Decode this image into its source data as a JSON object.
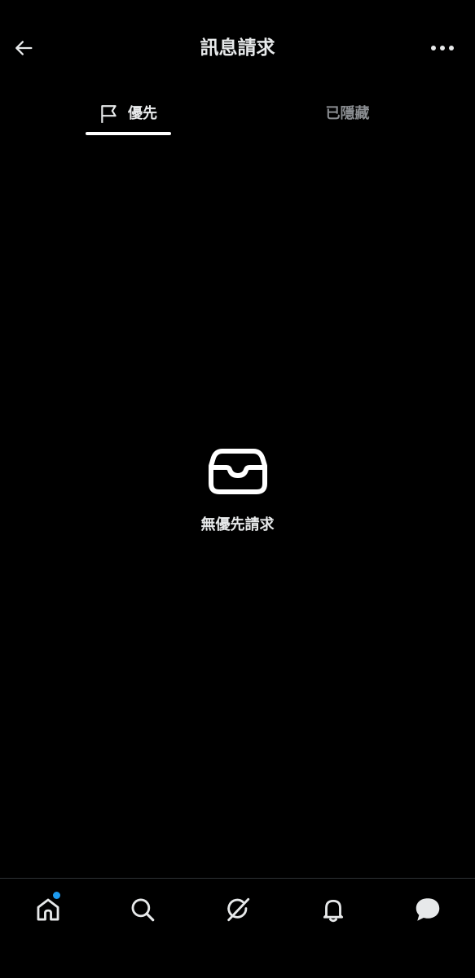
{
  "header": {
    "title": "訊息請求",
    "back_icon": "arrow-left-icon",
    "more_icon": "more-horizontal-icon"
  },
  "tabs": [
    {
      "label": "優先",
      "icon": "flag-icon",
      "active": true
    },
    {
      "label": "已隱藏",
      "active": false
    }
  ],
  "empty_state": {
    "icon": "inbox-icon",
    "text": "無優先請求"
  },
  "bottom_nav": {
    "items": [
      {
        "name": "home",
        "icon": "home-icon",
        "has_notification": true
      },
      {
        "name": "search",
        "icon": "search-icon"
      },
      {
        "name": "grok",
        "icon": "grok-icon"
      },
      {
        "name": "notifications",
        "icon": "bell-icon"
      },
      {
        "name": "messages",
        "icon": "message-bubble-icon",
        "active": true
      }
    ]
  },
  "colors": {
    "background": "#000000",
    "text_primary": "#e7e9ea",
    "text_secondary": "#8a8d91",
    "accent_blue": "#1d9bf0",
    "divider": "#2f3336"
  }
}
